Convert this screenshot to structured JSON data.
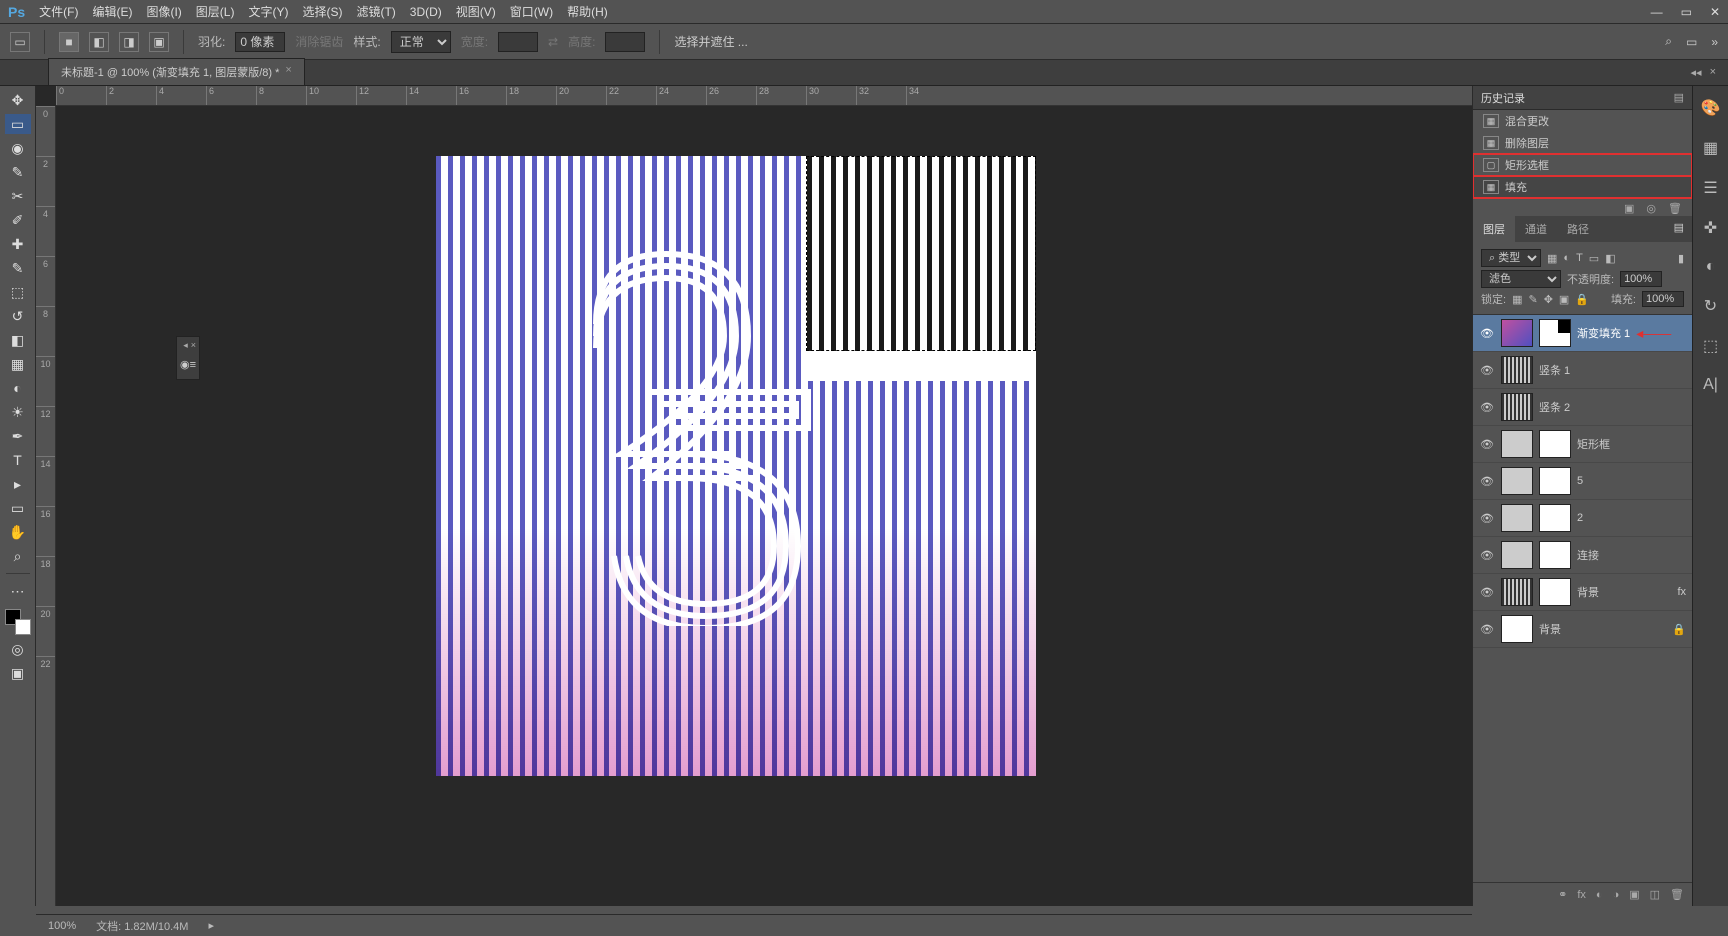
{
  "menubar": {
    "logo": "Ps",
    "items": [
      "文件(F)",
      "编辑(E)",
      "图像(I)",
      "图层(L)",
      "文字(Y)",
      "选择(S)",
      "滤镜(T)",
      "3D(D)",
      "视图(V)",
      "窗口(W)",
      "帮助(H)"
    ]
  },
  "optbar": {
    "feather_label": "羽化:",
    "feather_value": "0 像素",
    "antialias": "消除锯齿",
    "style_label": "样式:",
    "style_value": "正常",
    "width_label": "宽度:",
    "height_label": "高度:",
    "refine": "选择并遮住 ..."
  },
  "tab": {
    "title": "未标题-1 @ 100% (渐变填充 1, 图层蒙版/8) *"
  },
  "history": {
    "title": "历史记录",
    "items": [
      {
        "icon": "▦",
        "label": "混合更改"
      },
      {
        "icon": "▦",
        "label": "删除图层"
      },
      {
        "icon": "▢",
        "label": "矩形选框"
      },
      {
        "icon": "▦",
        "label": "填充"
      }
    ]
  },
  "layers_panel": {
    "tabs": [
      "图层",
      "通道",
      "路径"
    ],
    "kind_label": "⌕ 类型",
    "blend": "滤色",
    "opacity_label": "不透明度:",
    "opacity": "100%",
    "lock_label": "锁定:",
    "fill_label": "填充:",
    "fill": "100%",
    "layers": [
      {
        "name": "渐变填充 1",
        "sel": true,
        "mask": true,
        "arrow": true
      },
      {
        "name": "竖条 1"
      },
      {
        "name": "竖条 2"
      },
      {
        "name": "矩形框",
        "mask": true
      },
      {
        "name": "5",
        "mask": true
      },
      {
        "name": "2",
        "mask": true
      },
      {
        "name": "连接",
        "mask": true
      },
      {
        "name": "背景",
        "mask": true,
        "fx": true
      },
      {
        "name": "背景",
        "lock": true
      }
    ]
  },
  "status": {
    "zoom": "100%",
    "doc": "文档: 1.82M/10.4M"
  }
}
